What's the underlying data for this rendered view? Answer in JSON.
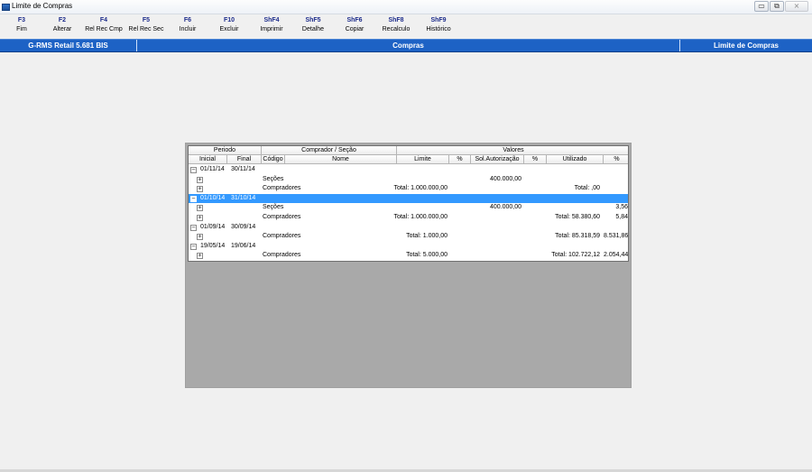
{
  "window": {
    "title": "Limite de Compras",
    "btn_min": "▭",
    "btn_max": "⧉",
    "btn_close": "⨯"
  },
  "toolbar": [
    {
      "key": "F3",
      "label": "Fim"
    },
    {
      "key": "F2",
      "label": "Alterar"
    },
    {
      "key": "F4",
      "label": "Rel Rec Cmp"
    },
    {
      "key": "F5",
      "label": "Rel Rec Sec"
    },
    {
      "key": "F6",
      "label": "Incluir"
    },
    {
      "key": "F10",
      "label": "Excluir"
    },
    {
      "key": "ShF4",
      "label": "Imprimir"
    },
    {
      "key": "ShF5",
      "label": "Detalhe"
    },
    {
      "key": "ShF6",
      "label": "Copiar"
    },
    {
      "key": "ShF8",
      "label": "Recalculo"
    },
    {
      "key": "ShF9",
      "label": "Histórico"
    }
  ],
  "header": {
    "left": "G-RMS Retail 5.681 BIS",
    "center": "Compras",
    "right": "Limite de Compras"
  },
  "grid": {
    "group_headers": {
      "periodo": "Periodo",
      "comprador": "Comprador / Seção",
      "valores": "Valores"
    },
    "columns": {
      "inicial": "Inicial",
      "final": "Final",
      "codigo": "Código",
      "nome": "Nome",
      "limite": "Limite",
      "pct1": "%",
      "sol": "Sol.Autorização",
      "pct2": "%",
      "utilizado": "Utilizado",
      "pct3": "%"
    },
    "rows": [
      {
        "type": "period",
        "box": "−",
        "inicial": "01/11/14",
        "final": "30/11/14"
      },
      {
        "type": "child",
        "box": "+",
        "nome": "Seções",
        "limite": "",
        "sol": "400.000,00",
        "utilizado": "",
        "pct3": ""
      },
      {
        "type": "child",
        "box": "+",
        "nome": "Compradores",
        "limite": "Total: 1.000.000,00",
        "sol": "",
        "utilizado": "Total: ,00",
        "pct3": ""
      },
      {
        "type": "period",
        "box": "−",
        "inicial": "01/10/14",
        "final": "31/10/14",
        "selected": true
      },
      {
        "type": "child",
        "box": "+",
        "nome": "Seções",
        "limite": "",
        "sol": "400.000,00",
        "utilizado": "",
        "pct3": "3,56"
      },
      {
        "type": "child",
        "box": "+",
        "nome": "Compradores",
        "limite": "Total: 1.000.000,00",
        "sol": "",
        "utilizado": "Total: 58.380,60",
        "pct3": "5,84"
      },
      {
        "type": "period",
        "box": "−",
        "inicial": "01/09/14",
        "final": "30/09/14"
      },
      {
        "type": "child",
        "box": "+",
        "nome": "Compradores",
        "limite": "Total: 1.000,00",
        "sol": "",
        "utilizado": "Total: 85.318,59",
        "pct3": "8.531,86"
      },
      {
        "type": "period",
        "box": "−",
        "inicial": "19/05/14",
        "final": "19/06/14"
      },
      {
        "type": "child",
        "box": "+",
        "nome": "Compradores",
        "limite": "Total: 5.000,00",
        "sol": "",
        "utilizado": "Total: 102.722,12",
        "pct3": "2.054,44"
      }
    ]
  }
}
